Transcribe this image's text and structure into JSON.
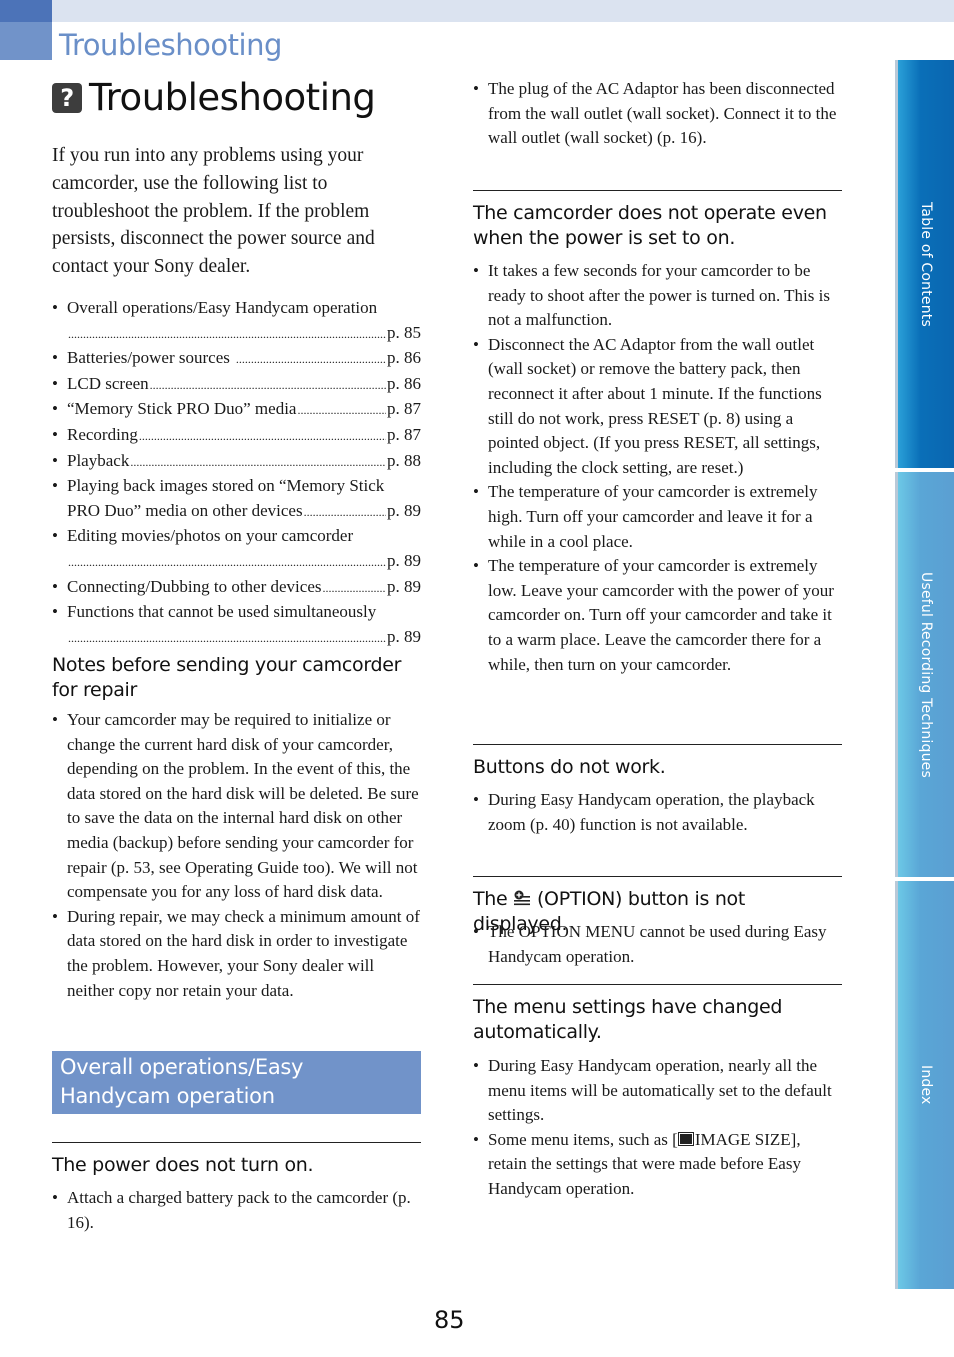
{
  "header": {
    "section_title": "Troubleshooting",
    "page_title": "Troubleshooting",
    "title_icon": "question-mark-icon"
  },
  "intro": "If you run into any problems using your camcorder, use the following list to troubleshoot the problem. If the problem persists, disconnect the power source and contact your Sony dealer.",
  "toc": [
    {
      "label": "Overall operations/Easy Handycam operation",
      "page": "p. 85",
      "wrap": true
    },
    {
      "label": "Batteries/power sources",
      "page": "p. 86"
    },
    {
      "label": "LCD screen",
      "page": "p. 86"
    },
    {
      "label": "“Memory Stick PRO Duo” media",
      "page": "p. 87"
    },
    {
      "label": "Recording",
      "page": "p. 87"
    },
    {
      "label": "Playback",
      "page": "p. 88"
    },
    {
      "label_line1": "Playing back images stored on “Memory Stick",
      "label": "PRO Duo” media on other devices",
      "page": "p. 89"
    },
    {
      "label": "Editing movies/photos on your camcorder",
      "page": "p. 89",
      "wrap": true
    },
    {
      "label": "Connecting/Dubbing to other devices",
      "page": "p. 89"
    },
    {
      "label": "Functions that cannot be used simultaneously",
      "page": "p. 89",
      "wrap": true
    }
  ],
  "notes": {
    "heading": "Notes before sending your camcorder for repair",
    "items": [
      "Your camcorder may be required to initialize or change the current hard disk of your camcorder, depending on the problem. In the event of this, the data stored on the hard disk will be deleted. Be sure to save the data on the internal hard disk on other media (backup) before sending your camcorder for repair (p. 53, see Operating Guide too). We will not compensate you for any loss of hard disk data.",
      "During repair, we may check a minimum amount of data stored on the hard disk in order to investigate the problem. However, your Sony dealer will neither copy nor retain your data."
    ]
  },
  "section_bar": "Overall operations/Easy Handycam operation",
  "problems": {
    "power": {
      "heading": "The power does not turn on.",
      "items": [
        "Attach a charged battery pack to the camcorder (p. 16).",
        "The plug of the AC Adaptor has been disconnected from the wall outlet (wall socket). Connect it to the wall outlet (wall socket) (p. 16)."
      ]
    },
    "not_operate": {
      "heading": "The camcorder does not operate even when the power is set to on.",
      "items": [
        "It takes a few seconds for your camcorder to be ready to shoot after the power is turned on. This is not a malfunction.",
        "Disconnect the AC Adaptor from the wall outlet (wall socket) or remove the battery pack, then reconnect it after about 1 minute. If the functions still do not work, press RESET (p. 8) using a pointed object. (If you press RESET, all settings, including the clock setting, are reset.)",
        "The temperature of your camcorder is extremely high. Turn off your camcorder and leave it for a while in a cool place.",
        "The temperature of your camcorder is extremely low. Leave your camcorder with the power of your camcorder on. Turn off your camcorder and take it to a warm place. Leave the camcorder there for a while, then turn on your camcorder."
      ]
    },
    "buttons": {
      "heading": "Buttons do not work.",
      "items": [
        "During Easy Handycam operation, the playback zoom (p. 40) function is not available."
      ]
    },
    "option": {
      "heading_pre": "The",
      "heading_post": "(OPTION) button is not displayed.",
      "icon": "option-button-icon",
      "items": [
        "The OPTION MENU cannot be used during Easy Handycam operation."
      ]
    },
    "menu": {
      "heading": "The menu settings have changed automatically.",
      "item1": "During Easy Handycam operation, nearly all the menu items will be automatically set to the default settings.",
      "item2_pre": "Some menu items, such as [",
      "item2_icon": "image-size-icon",
      "item2_post": "IMAGE SIZE], retain the settings that were made before Easy Handycam operation."
    }
  },
  "side_tabs": [
    {
      "label": "Table of Contents"
    },
    {
      "label": "Useful Recording Techniques"
    },
    {
      "label": "Index"
    }
  ],
  "page_number": "85"
}
